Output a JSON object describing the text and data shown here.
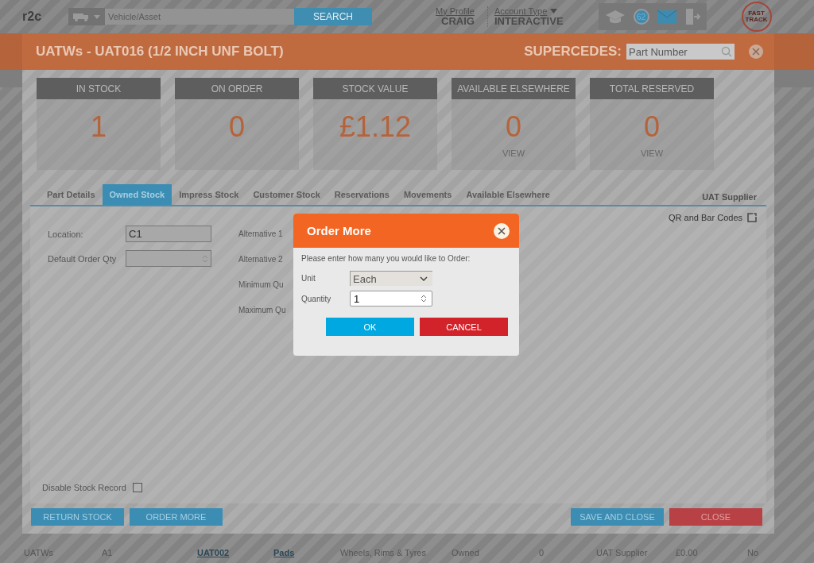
{
  "header": {
    "logo": "r2c",
    "search": {
      "placeholder": "Vehicle/Asset",
      "button": "SEARCH"
    },
    "profile_link": "My Profile",
    "user": "CRAIG",
    "account_type_link": "Account Type",
    "account_type": "INTERACTIVE",
    "notification_count": "62",
    "fast_track": "FAST TRACK"
  },
  "modal": {
    "title": "UATWs - UAT016 (1/2 INCH UNF BOLT)",
    "supercedes_label": "SUPERCEDES:",
    "supercedes_placeholder": "Part Number",
    "stats": [
      {
        "label": "IN STOCK",
        "value": "1"
      },
      {
        "label": "ON ORDER",
        "value": "0"
      },
      {
        "label": "STOCK VALUE",
        "value": "£1.12"
      },
      {
        "label": "AVAILABLE ELSEWHERE",
        "value": "0",
        "link": "VIEW"
      },
      {
        "label": "TOTAL RESERVED",
        "value": "0",
        "link": "VIEW"
      }
    ],
    "tabs": [
      {
        "label": "Part Details",
        "selected": false
      },
      {
        "label": "Owned Stock",
        "selected": true
      },
      {
        "label": "Impress Stock",
        "selected": false
      },
      {
        "label": "Customer Stock",
        "selected": false
      },
      {
        "label": "Reservations",
        "selected": false
      },
      {
        "label": "Movements",
        "selected": false
      },
      {
        "label": "Available Elsewhere",
        "selected": false
      }
    ],
    "supplier": "UAT Supplier",
    "qr_link": "QR and Bar Codes",
    "fields": [
      {
        "label": "Location:",
        "value": "C1",
        "kind": "text"
      },
      {
        "label": "Default Order Qty",
        "kind": "spinner"
      }
    ],
    "middle_labels": [
      "Alternative 1",
      "Alternative 2",
      "Minimum Qu",
      "Maximum Qu"
    ],
    "disable_stock_record": {
      "label": "Disable Stock Record",
      "checked": false
    },
    "buttons_left": [
      "RETURN STOCK",
      "ORDER MORE"
    ],
    "buttons_right": [
      {
        "label": "SAVE AND CLOSE",
        "kind": "primary"
      },
      {
        "label": "CLOSE",
        "kind": "danger"
      }
    ]
  },
  "background_row": [
    {
      "text": "UATWs",
      "kind": "text"
    },
    {
      "text": "A1",
      "kind": "text"
    },
    {
      "text": "UAT002",
      "kind": "link"
    },
    {
      "text": "Pads",
      "kind": "link"
    },
    {
      "text": "Wheels, Rims & Tyres",
      "kind": "text"
    },
    {
      "text": "Owned",
      "kind": "text"
    },
    {
      "text": "0",
      "kind": "text"
    },
    {
      "text": "UAT Supplier",
      "kind": "text"
    },
    {
      "text": "£0.00",
      "kind": "text"
    },
    {
      "text": "No",
      "kind": "text"
    }
  ],
  "dialog": {
    "title": "Order More",
    "message": "Please enter how many you would like to Order:",
    "unit_label": "Unit",
    "unit_value": "Each",
    "quantity_label": "Quantity",
    "quantity_value": "1",
    "ok": "OK",
    "cancel": "CANCEL"
  }
}
